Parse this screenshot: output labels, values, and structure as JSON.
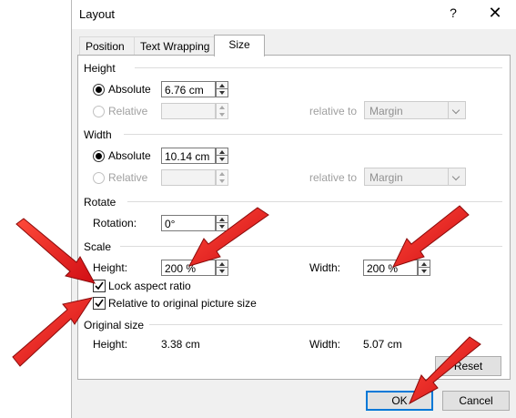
{
  "window": {
    "title": "Layout",
    "help": "?",
    "close": "✕"
  },
  "tabs": [
    {
      "label": "Position"
    },
    {
      "label": "Text Wrapping"
    },
    {
      "label": "Size"
    }
  ],
  "height": {
    "section": "Height",
    "absolute_label": "Absolute",
    "absolute_value": "6.76 cm",
    "relative_label": "Relative",
    "relative_to_label": "relative to",
    "relative_to_value": "Margin"
  },
  "width": {
    "section": "Width",
    "absolute_label": "Absolute",
    "absolute_value": "10.14 cm",
    "relative_label": "Relative",
    "relative_to_label": "relative to",
    "relative_to_value": "Margin"
  },
  "rotate": {
    "section": "Rotate",
    "rotation_label": "Rotation:",
    "rotation_value": "0°"
  },
  "scale": {
    "section": "Scale",
    "height_label": "Height:",
    "height_value": "200 %",
    "width_label": "Width:",
    "width_value": "200 %",
    "lock_aspect_label": "Lock aspect ratio",
    "lock_aspect_checked": true,
    "relative_original_label": "Relative to original picture size",
    "relative_original_checked": true
  },
  "original_size": {
    "section": "Original size",
    "height_label": "Height:",
    "height_value": "3.38 cm",
    "width_label": "Width:",
    "width_value": "5.07 cm"
  },
  "buttons": {
    "reset": "Reset",
    "ok": "OK",
    "cancel": "Cancel"
  },
  "colors": {
    "annotation_arrow": "#e8141b",
    "ok_focus": "#0078d7"
  }
}
